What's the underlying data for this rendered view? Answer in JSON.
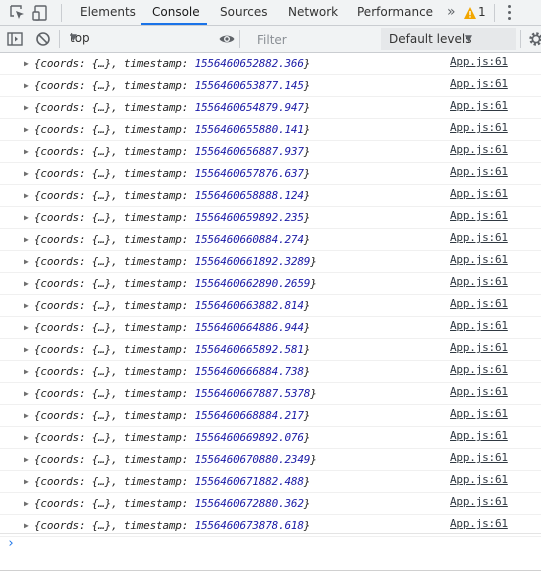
{
  "tabs": [
    {
      "label": "Elements"
    },
    {
      "label": "Console"
    },
    {
      "label": "Sources"
    },
    {
      "label": "Network"
    },
    {
      "label": "Performance"
    }
  ],
  "overflow_label": "»",
  "warning_count": "1",
  "toolbar": {
    "context": "top",
    "filter_placeholder": "Filter",
    "levels": "Default levels"
  },
  "colors": {
    "accent": "#1a73e8",
    "timestamp": "#1a1aa6",
    "warning": "#f2a600"
  },
  "log_entries": [
    {
      "prefix": "{coords: {…}, timestamp: ",
      "timestamp": "1556460652882.366",
      "suffix": "}",
      "source": "App.js:61"
    },
    {
      "prefix": "{coords: {…}, timestamp: ",
      "timestamp": "1556460653877.145",
      "suffix": "}",
      "source": "App.js:61"
    },
    {
      "prefix": "{coords: {…}, timestamp: ",
      "timestamp": "1556460654879.947",
      "suffix": "}",
      "source": "App.js:61"
    },
    {
      "prefix": "{coords: {…}, timestamp: ",
      "timestamp": "1556460655880.141",
      "suffix": "}",
      "source": "App.js:61"
    },
    {
      "prefix": "{coords: {…}, timestamp: ",
      "timestamp": "1556460656887.937",
      "suffix": "}",
      "source": "App.js:61"
    },
    {
      "prefix": "{coords: {…}, timestamp: ",
      "timestamp": "1556460657876.637",
      "suffix": "}",
      "source": "App.js:61"
    },
    {
      "prefix": "{coords: {…}, timestamp: ",
      "timestamp": "1556460658888.124",
      "suffix": "}",
      "source": "App.js:61"
    },
    {
      "prefix": "{coords: {…}, timestamp: ",
      "timestamp": "1556460659892.235",
      "suffix": "}",
      "source": "App.js:61"
    },
    {
      "prefix": "{coords: {…}, timestamp: ",
      "timestamp": "1556460660884.274",
      "suffix": "}",
      "source": "App.js:61"
    },
    {
      "prefix": "{coords: {…}, timestamp: ",
      "timestamp": "1556460661892.3289",
      "suffix": "}",
      "source": "App.js:61"
    },
    {
      "prefix": "{coords: {…}, timestamp: ",
      "timestamp": "1556460662890.2659",
      "suffix": "}",
      "source": "App.js:61"
    },
    {
      "prefix": "{coords: {…}, timestamp: ",
      "timestamp": "1556460663882.814",
      "suffix": "}",
      "source": "App.js:61"
    },
    {
      "prefix": "{coords: {…}, timestamp: ",
      "timestamp": "1556460664886.944",
      "suffix": "}",
      "source": "App.js:61"
    },
    {
      "prefix": "{coords: {…}, timestamp: ",
      "timestamp": "1556460665892.581",
      "suffix": "}",
      "source": "App.js:61"
    },
    {
      "prefix": "{coords: {…}, timestamp: ",
      "timestamp": "1556460666884.738",
      "suffix": "}",
      "source": "App.js:61"
    },
    {
      "prefix": "{coords: {…}, timestamp: ",
      "timestamp": "1556460667887.5378",
      "suffix": "}",
      "source": "App.js:61"
    },
    {
      "prefix": "{coords: {…}, timestamp: ",
      "timestamp": "1556460668884.217",
      "suffix": "}",
      "source": "App.js:61"
    },
    {
      "prefix": "{coords: {…}, timestamp: ",
      "timestamp": "1556460669892.076",
      "suffix": "}",
      "source": "App.js:61"
    },
    {
      "prefix": "{coords: {…}, timestamp: ",
      "timestamp": "1556460670880.2349",
      "suffix": "}",
      "source": "App.js:61"
    },
    {
      "prefix": "{coords: {…}, timestamp: ",
      "timestamp": "1556460671882.488",
      "suffix": "}",
      "source": "App.js:61"
    },
    {
      "prefix": "{coords: {…}, timestamp: ",
      "timestamp": "1556460672880.362",
      "suffix": "}",
      "source": "App.js:61"
    },
    {
      "prefix": "{coords: {…}, timestamp: ",
      "timestamp": "1556460673878.618",
      "suffix": "}",
      "source": "App.js:61"
    }
  ],
  "prompt_symbol": "›"
}
